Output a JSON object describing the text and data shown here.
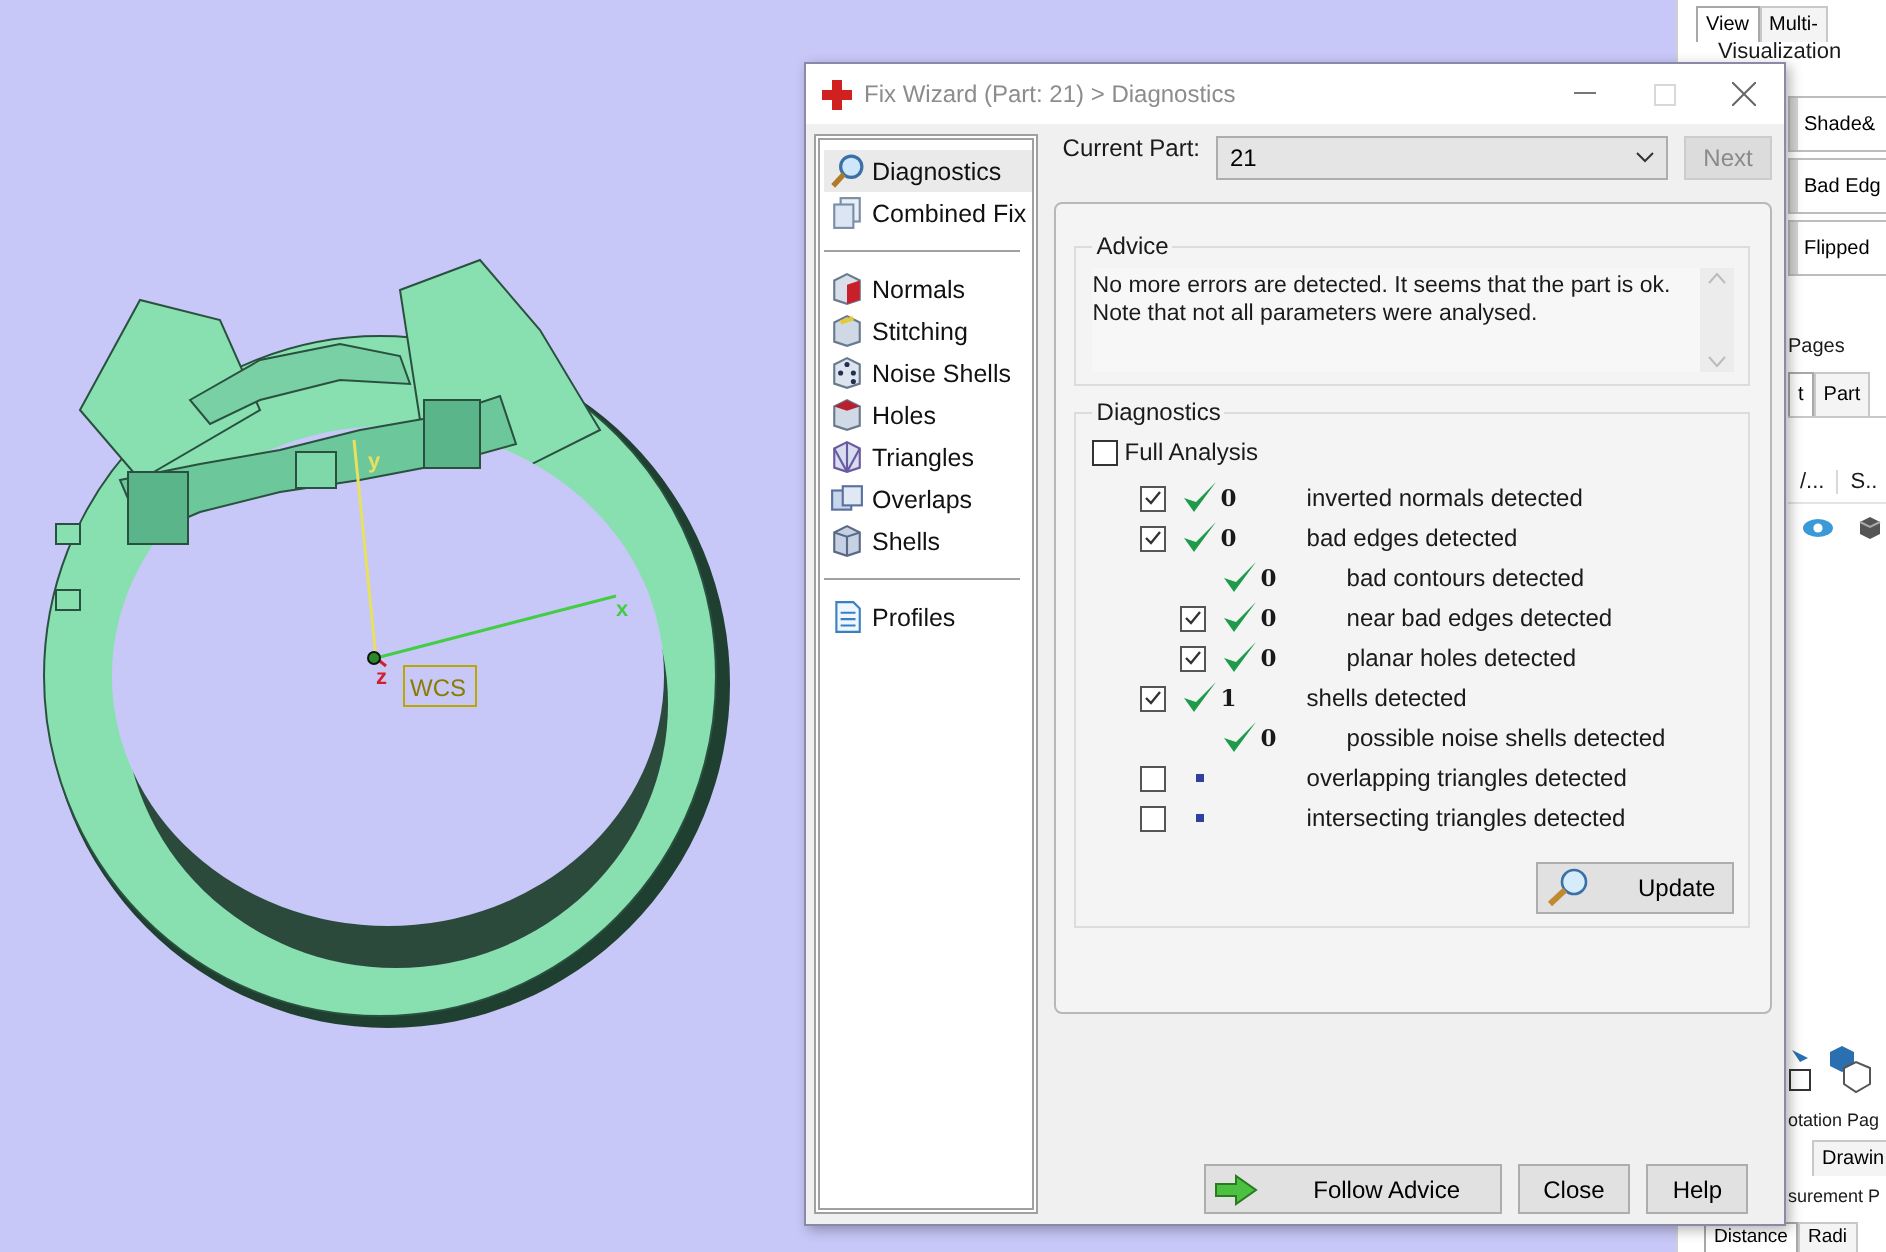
{
  "viewport": {
    "axes": [
      {
        "kind": "x",
        "label": "x"
      },
      {
        "kind": "y",
        "label": "y"
      },
      {
        "kind": "z",
        "label": "z"
      }
    ],
    "frame_label": "WCS"
  },
  "side_panel": {
    "tabs": [
      {
        "label": "View",
        "selected": true
      },
      {
        "label": "Multi-",
        "selected": false
      }
    ],
    "group_title": "Visualization",
    "buttons": [
      "Shade&",
      "Bad Edg",
      "Flipped"
    ],
    "pages_title": "Pages",
    "page_tabs": [
      {
        "label": "t",
        "selected": true
      },
      {
        "label": "Part",
        "selected": false
      }
    ],
    "columns": [
      "/...",
      "S.."
    ],
    "annotation_title": "otation Pag",
    "annotation_tabs": [
      {
        "label": "Drawin",
        "selected": false
      }
    ],
    "measurement_title": "surement P",
    "measurement_tabs": [
      {
        "label": "Distance",
        "selected": true
      },
      {
        "label": "Radi",
        "selected": false
      }
    ]
  },
  "dialog": {
    "title": "Fix Wizard (Part: 21) > Diagnostics",
    "maximize": {
      "disabled": true
    },
    "nav": [
      [
        {
          "label": "Diagnostics",
          "kind": "search",
          "selected": true
        },
        {
          "label": "Combined Fix",
          "kind": "sheets",
          "selected": false
        }
      ],
      [
        {
          "label": "Normals",
          "kind": "normals",
          "selected": false
        },
        {
          "label": "Stitching",
          "kind": "stitch",
          "selected": false
        },
        {
          "label": "Noise Shells",
          "kind": "dice",
          "selected": false
        },
        {
          "label": "Holes",
          "kind": "hole",
          "selected": false
        },
        {
          "label": "Triangles",
          "kind": "triangles",
          "selected": false
        },
        {
          "label": "Overlaps",
          "kind": "overlaps",
          "selected": false
        },
        {
          "label": "Shells",
          "kind": "shells",
          "selected": false
        }
      ],
      [
        {
          "label": "Profiles",
          "kind": "document",
          "selected": false
        }
      ]
    ],
    "current_part": {
      "label": "Current Part:",
      "value": "21"
    },
    "next_button": {
      "label": "Next",
      "disabled": true
    },
    "advice": {
      "title": "Advice",
      "lines": [
        "No more errors are detected. It seems that the part is ok.",
        "Note that not all parameters were analysed."
      ]
    },
    "diagnostics": {
      "title": "Diagnostics",
      "full_analysis": {
        "label": "Full Analysis",
        "checked": false
      },
      "rows": [
        {
          "kind": "check",
          "checked": true,
          "passed": true,
          "count": "0",
          "label": "inverted normals detected"
        },
        {
          "kind": "check",
          "checked": true,
          "passed": true,
          "count": "0",
          "label": "bad edges detected",
          "children": [
            {
              "kind": "plain",
              "passed": true,
              "count": "0",
              "label": "bad contours detected"
            },
            {
              "kind": "check",
              "checked": true,
              "passed": true,
              "count": "0",
              "label": "near bad edges detected"
            },
            {
              "kind": "check",
              "checked": true,
              "passed": true,
              "count": "0",
              "label": "planar holes detected"
            }
          ]
        },
        {
          "kind": "check",
          "checked": true,
          "passed": true,
          "count": "1",
          "label": "shells detected",
          "children": [
            {
              "kind": "plain",
              "passed": true,
              "count": "0",
              "label": "possible noise shells detected"
            }
          ]
        },
        {
          "kind": "check",
          "checked": false,
          "passed": false,
          "label": "overlapping triangles detected"
        },
        {
          "kind": "check",
          "checked": false,
          "passed": false,
          "label": "intersecting triangles detected"
        }
      ],
      "update_button": {
        "label": "Update"
      }
    },
    "buttons": [
      {
        "label": "Follow Advice",
        "kind": "arrow"
      },
      {
        "label": "Close"
      },
      {
        "label": "Help"
      }
    ]
  }
}
